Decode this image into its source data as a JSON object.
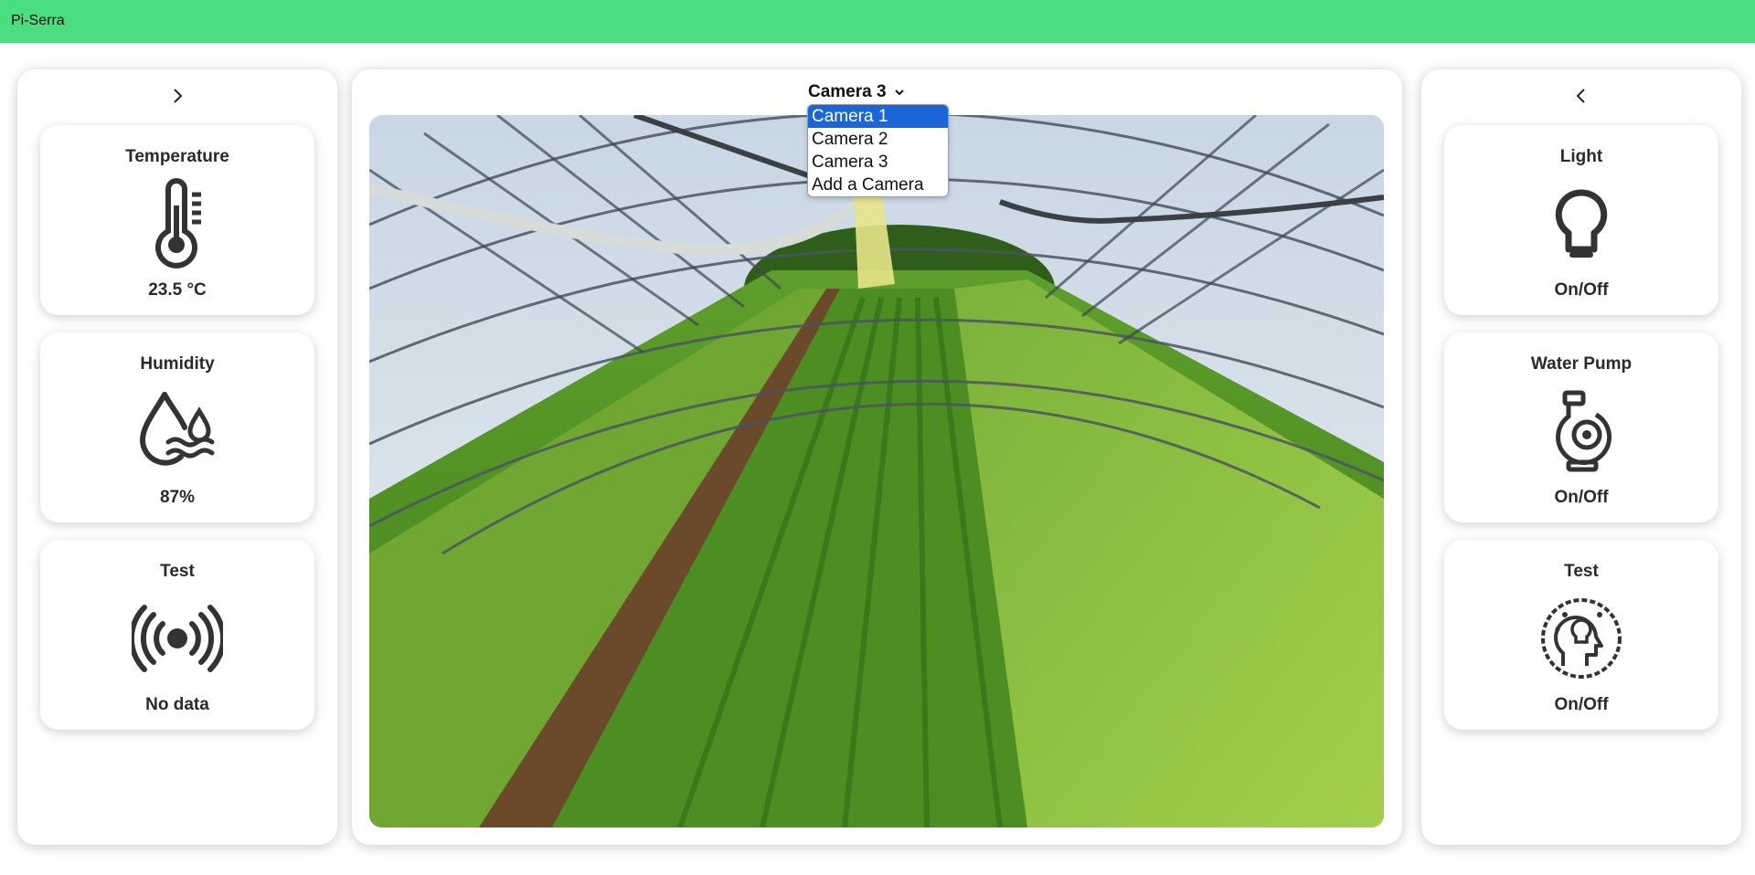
{
  "app": {
    "title": "Pi-Serra"
  },
  "left_panel": {
    "cards": [
      {
        "title": "Temperature",
        "icon": "thermometer-icon",
        "value": "23.5 °C"
      },
      {
        "title": "Humidity",
        "icon": "humidity-drops-icon",
        "value": "87%"
      },
      {
        "title": "Test",
        "icon": "signal-broadcast-icon",
        "value": "No data"
      }
    ]
  },
  "camera": {
    "selected": "Camera 3",
    "options": [
      "Camera 1",
      "Camera 2",
      "Camera 3",
      "Add a Camera"
    ],
    "highlighted_option": "Camera 1"
  },
  "right_panel": {
    "cards": [
      {
        "title": "Light",
        "icon": "light-bulb-icon",
        "value": "On/Off"
      },
      {
        "title": "Water Pump",
        "icon": "water-pump-icon",
        "value": "On/Off"
      },
      {
        "title": "Test",
        "icon": "idea-head-icon",
        "value": "On/Off"
      }
    ]
  },
  "colors": {
    "topbar": "#4ade80",
    "option_highlight": "#1a66d9"
  }
}
